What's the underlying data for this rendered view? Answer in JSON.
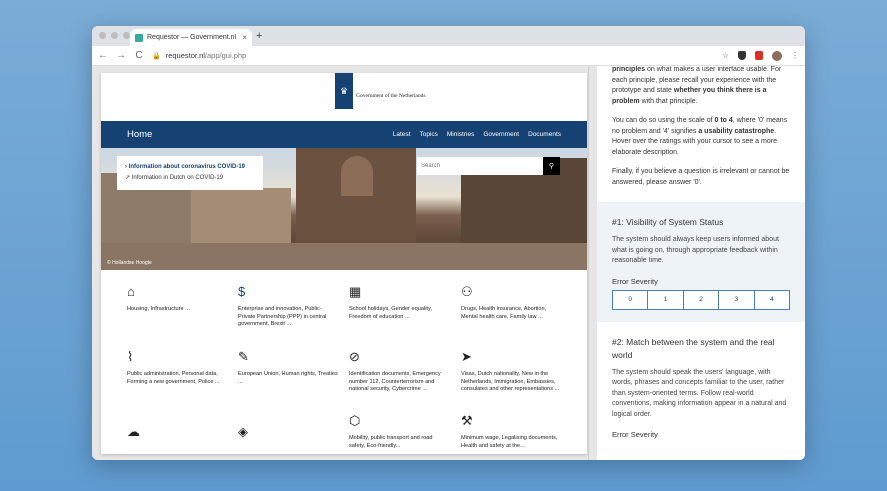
{
  "browser": {
    "tab_title": "Requestor — Government.nl D",
    "tab_close": "×",
    "new_tab": "+",
    "url_domain": "requestor.nl",
    "url_path": "/app/gui.php",
    "back": "←",
    "forward": "→",
    "reload": "C",
    "star": "☆",
    "menu": "⋮",
    "lock": "🔒"
  },
  "site": {
    "gov_name": "Government of the Netherlands",
    "nav_home": "Home",
    "nav_links": [
      "Latest",
      "Topics",
      "Ministries",
      "Government",
      "Documents"
    ],
    "covid_link_1": "Information about coronavirus COVID-19",
    "covid_link_2": "Information in Dutch on COVID-19",
    "search_placeholder": "Search",
    "photo_credit": "© Hollandse Hoogte",
    "topics": [
      {
        "icon": "⌂",
        "text": "Housing, Infrastructure ..."
      },
      {
        "icon": "$",
        "text": "Enterprise and innovation, Public-Private Partnership (PPP) in central government, Brexit ..."
      },
      {
        "icon": "▦",
        "text": "School holidays, Gender equality, Freedom of education ..."
      },
      {
        "icon": "⚇",
        "text": "Drugs, Health insurance, Abortion, Mental health care, Family law ..."
      },
      {
        "icon": "⌇",
        "text": "Public administration, Personal data, Forming a new government, Police ..."
      },
      {
        "icon": "✎",
        "text": "European Union, Human rights, Treaties ..."
      },
      {
        "icon": "⊘",
        "text": "Identification documents, Emergency number 112, Counterterrorism and national security, Cybercrime ..."
      },
      {
        "icon": "➤",
        "text": "Visas, Dutch nationality, New in the Netherlands, Immigration, Embassies, consulates and other representations ..."
      },
      {
        "icon": "☁",
        "text": ""
      },
      {
        "icon": "◈",
        "text": ""
      },
      {
        "icon": "⬡",
        "text": "Mobility, public transport and road safety, Eco-friendly..."
      },
      {
        "icon": "⚒",
        "text": "Minimum wage, Legalising documents, Health and safety at the..."
      }
    ]
  },
  "panel": {
    "intro_1a": "principles",
    "intro_1b": " on what makes a user interface usable. For each principle, please recall your experience with the prototype and state ",
    "intro_1c": "whether you think there is a problem",
    "intro_1d": " with that principle.",
    "intro_2a": "You can do so using the scale of ",
    "intro_2b": "0 to 4",
    "intro_2c": ", where '0' means no problem and '4' signifies ",
    "intro_2d": "a usability catastrophe",
    "intro_2e": ". Hover over the ratings with your cursor to see a more elaborate description.",
    "intro_3": "Finally, if you believe a question is irrelevant or cannot be answered, please answer '0'.",
    "principles": [
      {
        "title": "#1: Visibility of System Status",
        "desc": "The system should always keep users informed about what is going on, through appropriate feedback within reasonable time.",
        "severity_label": "Error Severity",
        "options": [
          "0",
          "1",
          "2",
          "3",
          "4"
        ]
      },
      {
        "title": "#2: Match between the system and the real world",
        "desc": "The system should speak the users' language, with words, phrases and concepts familiar to the user, rather than system-oriented terms. Follow real-world conventions, making information appear in a natural and logical order.",
        "severity_label": "Error Severity"
      }
    ]
  }
}
